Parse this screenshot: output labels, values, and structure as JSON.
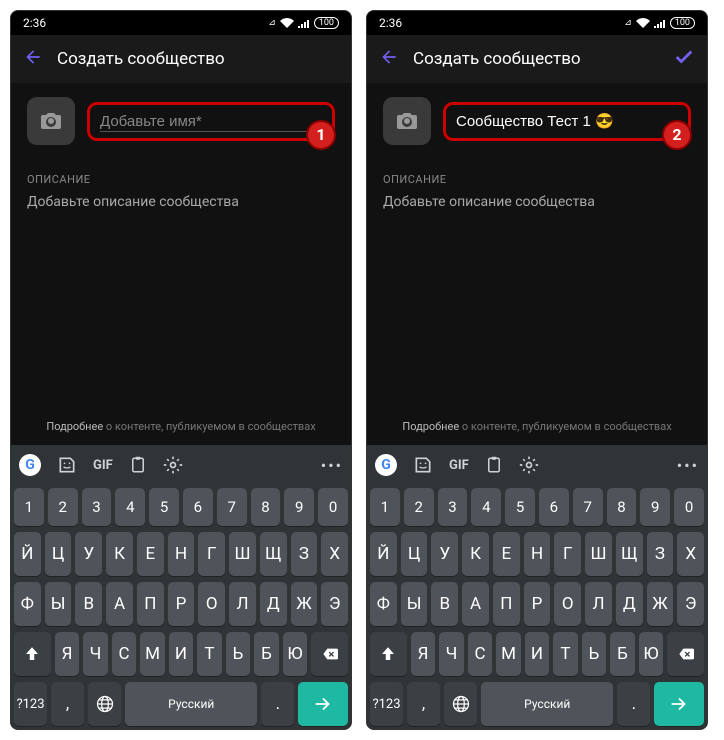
{
  "status": {
    "time": "2:36",
    "battery": "100"
  },
  "header": {
    "title": "Создать сообщество"
  },
  "screens": [
    {
      "show_check": false,
      "name_value": "",
      "name_placeholder": "Добавьте имя*",
      "badge": "1"
    },
    {
      "show_check": true,
      "name_value": "Сообщество Тест 1 😎",
      "name_placeholder": "Добавьте имя*",
      "badge": "2"
    }
  ],
  "desc": {
    "label": "ОПИСАНИЕ",
    "placeholder": "Добавьте описание сообщества"
  },
  "info": {
    "link_word": "Подробнее",
    "rest": " о контенте, публикуемом в сообществах"
  },
  "keyboard": {
    "gif": "GIF",
    "nums": [
      "1",
      "2",
      "3",
      "4",
      "5",
      "6",
      "7",
      "8",
      "9",
      "0"
    ],
    "row1": [
      "Й",
      "Ц",
      "У",
      "К",
      "Е",
      "Н",
      "Г",
      "Ш",
      "Щ",
      "З",
      "Х"
    ],
    "row2": [
      "Ф",
      "Ы",
      "В",
      "А",
      "П",
      "Р",
      "О",
      "Л",
      "Д",
      "Ж",
      "Э"
    ],
    "row3": [
      "Я",
      "Ч",
      "С",
      "М",
      "И",
      "Т",
      "Ь",
      "Б",
      "Ю"
    ],
    "sym": "?123",
    "lang": "Русский"
  }
}
